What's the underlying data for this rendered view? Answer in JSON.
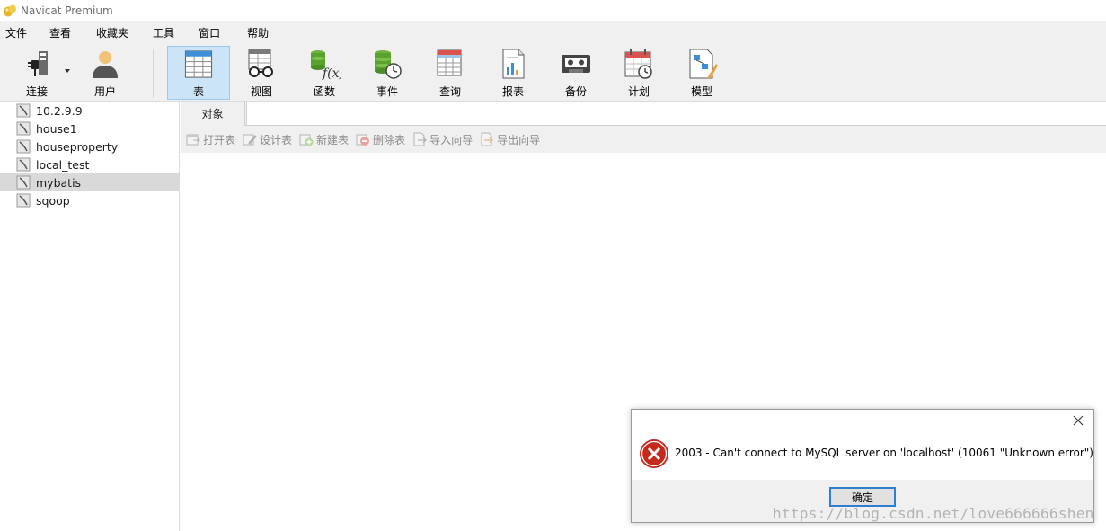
{
  "window": {
    "title": "Navicat Premium"
  },
  "menu": [
    "文件",
    "查看",
    "收藏夹",
    "工具",
    "窗口",
    "帮助"
  ],
  "toolbar": {
    "connect": "连接",
    "user": "用户",
    "table": "表",
    "view": "视图",
    "function": "函数",
    "event": "事件",
    "query": "查询",
    "report": "报表",
    "backup": "备份",
    "schedule": "计划",
    "model": "模型"
  },
  "connections": [
    "10.2.9.9",
    "house1",
    "houseproperty",
    "local_test",
    "mybatis",
    "sqoop"
  ],
  "selected_connection": "mybatis",
  "object_tab": {
    "label": "对象"
  },
  "object_toolbar": {
    "open_table": "打开表",
    "design_table": "设计表",
    "new_table": "新建表",
    "delete_table": "删除表",
    "import_wizard": "导入向导",
    "export_wizard": "导出向导"
  },
  "dialog": {
    "message": "2003 - Can't connect to MySQL server on 'localhost' (10061 \"Unknown error\")",
    "ok_label": "确定"
  },
  "watermark": "https://blog.csdn.net/love666666shen",
  "colors": {
    "active_tool_bg": "#cce4f7",
    "selected_row_bg": "#d9d9d9",
    "error_red": "#c42b1c",
    "ok_border": "#2f7fd1"
  }
}
